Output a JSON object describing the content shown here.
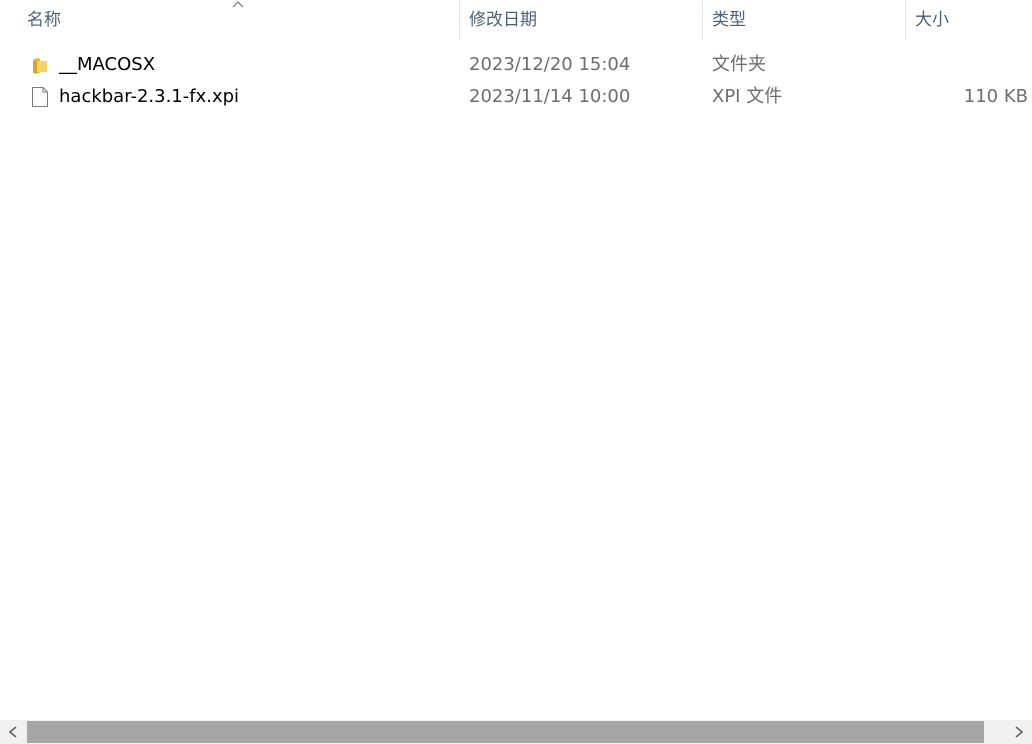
{
  "columns": {
    "name": "名称",
    "date_modified": "修改日期",
    "type": "类型",
    "size": "大小"
  },
  "sort": {
    "column": "name",
    "indicator": "sort-ascending-icon"
  },
  "files": [
    {
      "name": "__MACOSX",
      "date_modified": "2023/12/20 15:04",
      "type": "文件夹",
      "size": "",
      "icon": "folder-icon"
    },
    {
      "name": "hackbar-2.3.1-fx.xpi",
      "date_modified": "2023/11/14 10:00",
      "type": "XPI 文件",
      "size": "110 KB",
      "icon": "file-icon"
    }
  ],
  "colors": {
    "header_text": "#4c607a",
    "name_text": "#000000",
    "detail_text": "#6d6d6d",
    "folder": "#e8b830",
    "scroll_thumb": "#a6a6a6",
    "scroll_track": "#f0f0f0"
  }
}
